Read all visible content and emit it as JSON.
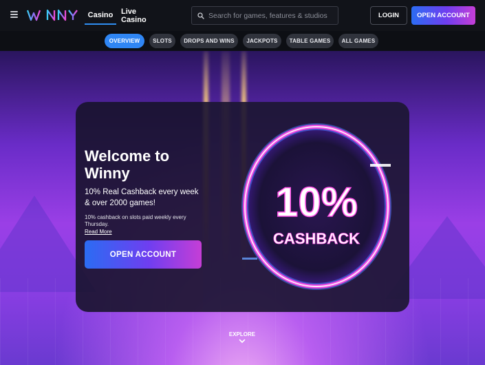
{
  "header": {
    "logo_text": "WINNY",
    "tabs": [
      {
        "label": "Casino",
        "active": true
      },
      {
        "label": "Live Casino",
        "active": false
      }
    ],
    "search_placeholder": "Search for games, features & studios",
    "login_label": "LOGIN",
    "open_account_label": "OPEN ACCOUNT"
  },
  "subnav": {
    "items": [
      {
        "label": "OVERVIEW",
        "active": true
      },
      {
        "label": "SLOTS",
        "active": false
      },
      {
        "label": "DROPS AND WINS",
        "active": false
      },
      {
        "label": "JACKPOTS",
        "active": false
      },
      {
        "label": "TABLE GAMES",
        "active": false
      },
      {
        "label": "ALL GAMES",
        "active": false
      }
    ]
  },
  "hero": {
    "title": "Welcome to Winny",
    "subtitle": "10% Real Cashback every week & over 2000 games!",
    "small_text": "10% cashback on slots paid weekly every Thursday.",
    "read_more": "Read More",
    "cta_label": "OPEN ACCOUNT",
    "badge_percent": "10%",
    "badge_label": "CASHBACK",
    "explore_label": "EXPLORE"
  },
  "colors": {
    "accent_blue": "#2f86f4",
    "gradient_start": "#2b6cf3",
    "gradient_end": "#c53ed6",
    "ring_neon": "#ff4fe8"
  }
}
